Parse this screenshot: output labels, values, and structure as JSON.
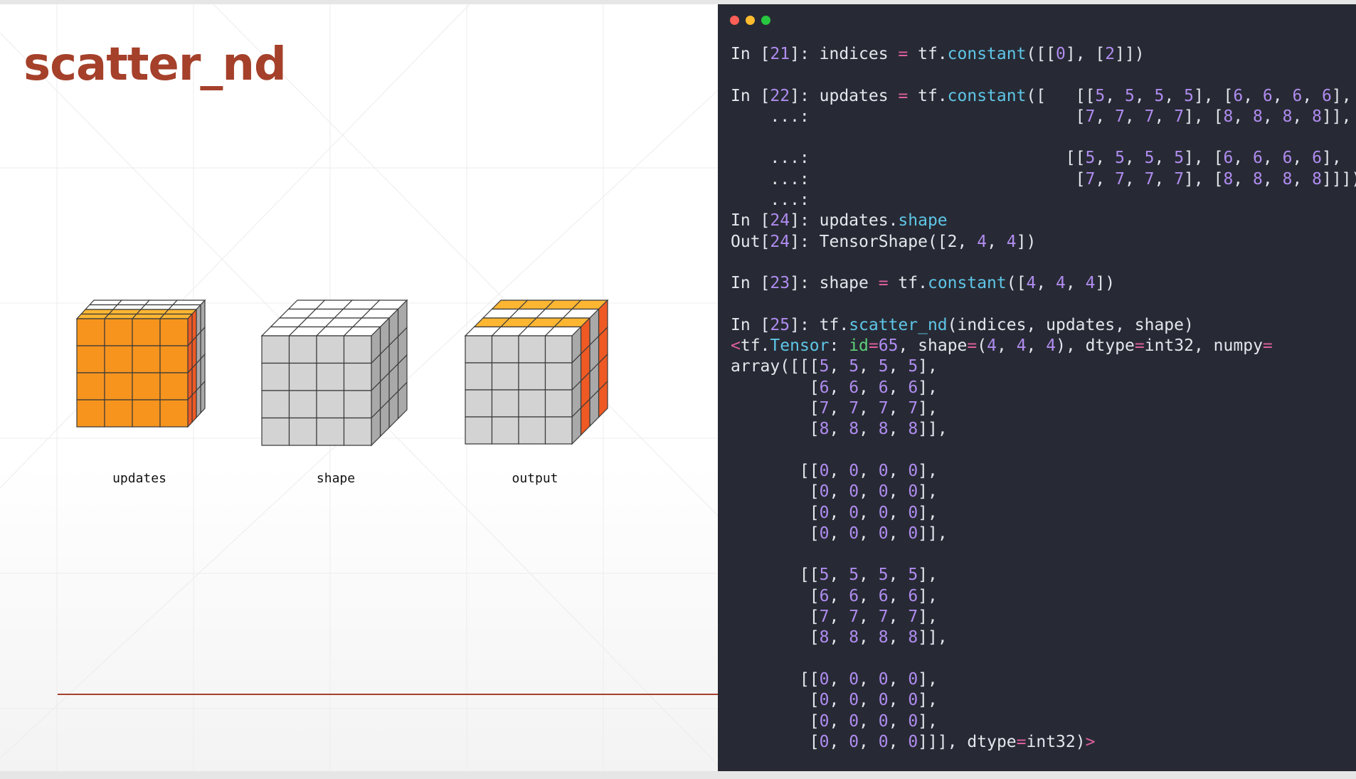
{
  "slide": {
    "title": "scatter_nd",
    "labels": {
      "updates": "updates",
      "shape": "shape",
      "output": "output"
    }
  },
  "colors": {
    "accent": "#a5402a",
    "cube_orange_front": "#f7941d",
    "cube_orange_top": "#fcb632",
    "cube_orange_side": "#ef5a24",
    "cube_gray_front": "#d3d3d3",
    "cube_gray_top": "#ffffff",
    "cube_gray_side": "#a9a9a9",
    "terminal_bg": "#272a34",
    "number": "#b08cf0",
    "function": "#5fc6e8",
    "operator": "#e05fa0",
    "keyword": "#5fd07a"
  },
  "terminal": {
    "lines": [
      [
        [
          "t",
          "In ["
        ],
        [
          "n",
          "21"
        ],
        [
          "t",
          "]: indices "
        ],
        [
          "o",
          "="
        ],
        [
          "t",
          " tf."
        ],
        [
          "f",
          "constant"
        ],
        [
          "t",
          "([["
        ],
        [
          "n",
          "0"
        ],
        [
          "t",
          "], ["
        ],
        [
          "n",
          "2"
        ],
        [
          "t",
          "]])"
        ]
      ],
      [],
      [
        [
          "t",
          "In ["
        ],
        [
          "n",
          "22"
        ],
        [
          "t",
          "]: updates "
        ],
        [
          "o",
          "="
        ],
        [
          "t",
          " tf."
        ],
        [
          "f",
          "constant"
        ],
        [
          "t",
          "([   [["
        ],
        [
          "n",
          "5"
        ],
        [
          "t",
          ", "
        ],
        [
          "n",
          "5"
        ],
        [
          "t",
          ", "
        ],
        [
          "n",
          "5"
        ],
        [
          "t",
          ", "
        ],
        [
          "n",
          "5"
        ],
        [
          "t",
          "], ["
        ],
        [
          "n",
          "6"
        ],
        [
          "t",
          ", "
        ],
        [
          "n",
          "6"
        ],
        [
          "t",
          ", "
        ],
        [
          "n",
          "6"
        ],
        [
          "t",
          ", "
        ],
        [
          "n",
          "6"
        ],
        [
          "t",
          "],"
        ]
      ],
      [
        [
          "t",
          "    ...:                           ["
        ],
        [
          "n",
          "7"
        ],
        [
          "t",
          ", "
        ],
        [
          "n",
          "7"
        ],
        [
          "t",
          ", "
        ],
        [
          "n",
          "7"
        ],
        [
          "t",
          ", "
        ],
        [
          "n",
          "7"
        ],
        [
          "t",
          "], ["
        ],
        [
          "n",
          "8"
        ],
        [
          "t",
          ", "
        ],
        [
          "n",
          "8"
        ],
        [
          "t",
          ", "
        ],
        [
          "n",
          "8"
        ],
        [
          "t",
          ", "
        ],
        [
          "n",
          "8"
        ],
        [
          "t",
          "]],"
        ]
      ],
      [],
      [
        [
          "t",
          "    ...:                          [["
        ],
        [
          "n",
          "5"
        ],
        [
          "t",
          ", "
        ],
        [
          "n",
          "5"
        ],
        [
          "t",
          ", "
        ],
        [
          "n",
          "5"
        ],
        [
          "t",
          ", "
        ],
        [
          "n",
          "5"
        ],
        [
          "t",
          "], ["
        ],
        [
          "n",
          "6"
        ],
        [
          "t",
          ", "
        ],
        [
          "n",
          "6"
        ],
        [
          "t",
          ", "
        ],
        [
          "n",
          "6"
        ],
        [
          "t",
          ", "
        ],
        [
          "n",
          "6"
        ],
        [
          "t",
          "],"
        ]
      ],
      [
        [
          "t",
          "    ...:                           ["
        ],
        [
          "n",
          "7"
        ],
        [
          "t",
          ", "
        ],
        [
          "n",
          "7"
        ],
        [
          "t",
          ", "
        ],
        [
          "n",
          "7"
        ],
        [
          "t",
          ", "
        ],
        [
          "n",
          "7"
        ],
        [
          "t",
          "], ["
        ],
        [
          "n",
          "8"
        ],
        [
          "t",
          ", "
        ],
        [
          "n",
          "8"
        ],
        [
          "t",
          ", "
        ],
        [
          "n",
          "8"
        ],
        [
          "t",
          ", "
        ],
        [
          "n",
          "8"
        ],
        [
          "t",
          "]]])"
        ]
      ],
      [
        [
          "t",
          "    ...:"
        ]
      ],
      [
        [
          "t",
          "In ["
        ],
        [
          "n",
          "24"
        ],
        [
          "t",
          "]: updates."
        ],
        [
          "f",
          "shape"
        ]
      ],
      [
        [
          "t",
          "Out["
        ],
        [
          "n",
          "24"
        ],
        [
          "t",
          "]: TensorShape([2, "
        ],
        [
          "n",
          "4"
        ],
        [
          "t",
          ", "
        ],
        [
          "n",
          "4"
        ],
        [
          "t",
          "])"
        ]
      ],
      [],
      [
        [
          "t",
          "In ["
        ],
        [
          "n",
          "23"
        ],
        [
          "t",
          "]: shape "
        ],
        [
          "o",
          "="
        ],
        [
          "t",
          " tf."
        ],
        [
          "f",
          "constant"
        ],
        [
          "t",
          "(["
        ],
        [
          "n",
          "4"
        ],
        [
          "t",
          ", "
        ],
        [
          "n",
          "4"
        ],
        [
          "t",
          ", "
        ],
        [
          "n",
          "4"
        ],
        [
          "t",
          "])"
        ]
      ],
      [],
      [
        [
          "t",
          "In ["
        ],
        [
          "n",
          "25"
        ],
        [
          "t",
          "]: tf."
        ],
        [
          "f",
          "scatter_nd"
        ],
        [
          "t",
          "(indices, updates, shape)"
        ]
      ],
      [
        [
          "o",
          "<"
        ],
        [
          "t",
          "tf."
        ],
        [
          "f",
          "Tensor"
        ],
        [
          "t",
          ": "
        ],
        [
          "k",
          "id"
        ],
        [
          "o",
          "="
        ],
        [
          "n",
          "65"
        ],
        [
          "t",
          ", shape"
        ],
        [
          "o",
          "="
        ],
        [
          "t",
          "("
        ],
        [
          "n",
          "4"
        ],
        [
          "t",
          ", "
        ],
        [
          "n",
          "4"
        ],
        [
          "t",
          ", "
        ],
        [
          "n",
          "4"
        ],
        [
          "t",
          "), dtype"
        ],
        [
          "o",
          "="
        ],
        [
          "t",
          "int32, numpy"
        ],
        [
          "o",
          "="
        ]
      ],
      [
        [
          "t",
          "array([[["
        ],
        [
          "n",
          "5"
        ],
        [
          "t",
          ", "
        ],
        [
          "n",
          "5"
        ],
        [
          "t",
          ", "
        ],
        [
          "n",
          "5"
        ],
        [
          "t",
          ", "
        ],
        [
          "n",
          "5"
        ],
        [
          "t",
          "],"
        ]
      ],
      [
        [
          "t",
          "        ["
        ],
        [
          "n",
          "6"
        ],
        [
          "t",
          ", "
        ],
        [
          "n",
          "6"
        ],
        [
          "t",
          ", "
        ],
        [
          "n",
          "6"
        ],
        [
          "t",
          ", "
        ],
        [
          "n",
          "6"
        ],
        [
          "t",
          "],"
        ]
      ],
      [
        [
          "t",
          "        ["
        ],
        [
          "n",
          "7"
        ],
        [
          "t",
          ", "
        ],
        [
          "n",
          "7"
        ],
        [
          "t",
          ", "
        ],
        [
          "n",
          "7"
        ],
        [
          "t",
          ", "
        ],
        [
          "n",
          "7"
        ],
        [
          "t",
          "],"
        ]
      ],
      [
        [
          "t",
          "        ["
        ],
        [
          "n",
          "8"
        ],
        [
          "t",
          ", "
        ],
        [
          "n",
          "8"
        ],
        [
          "t",
          ", "
        ],
        [
          "n",
          "8"
        ],
        [
          "t",
          ", "
        ],
        [
          "n",
          "8"
        ],
        [
          "t",
          "]],"
        ]
      ],
      [],
      [
        [
          "t",
          "       [["
        ],
        [
          "n",
          "0"
        ],
        [
          "t",
          ", "
        ],
        [
          "n",
          "0"
        ],
        [
          "t",
          ", "
        ],
        [
          "n",
          "0"
        ],
        [
          "t",
          ", "
        ],
        [
          "n",
          "0"
        ],
        [
          "t",
          "],"
        ]
      ],
      [
        [
          "t",
          "        ["
        ],
        [
          "n",
          "0"
        ],
        [
          "t",
          ", "
        ],
        [
          "n",
          "0"
        ],
        [
          "t",
          ", "
        ],
        [
          "n",
          "0"
        ],
        [
          "t",
          ", "
        ],
        [
          "n",
          "0"
        ],
        [
          "t",
          "],"
        ]
      ],
      [
        [
          "t",
          "        ["
        ],
        [
          "n",
          "0"
        ],
        [
          "t",
          ", "
        ],
        [
          "n",
          "0"
        ],
        [
          "t",
          ", "
        ],
        [
          "n",
          "0"
        ],
        [
          "t",
          ", "
        ],
        [
          "n",
          "0"
        ],
        [
          "t",
          "],"
        ]
      ],
      [
        [
          "t",
          "        ["
        ],
        [
          "n",
          "0"
        ],
        [
          "t",
          ", "
        ],
        [
          "n",
          "0"
        ],
        [
          "t",
          ", "
        ],
        [
          "n",
          "0"
        ],
        [
          "t",
          ", "
        ],
        [
          "n",
          "0"
        ],
        [
          "t",
          "]],"
        ]
      ],
      [],
      [
        [
          "t",
          "       [["
        ],
        [
          "n",
          "5"
        ],
        [
          "t",
          ", "
        ],
        [
          "n",
          "5"
        ],
        [
          "t",
          ", "
        ],
        [
          "n",
          "5"
        ],
        [
          "t",
          ", "
        ],
        [
          "n",
          "5"
        ],
        [
          "t",
          "],"
        ]
      ],
      [
        [
          "t",
          "        ["
        ],
        [
          "n",
          "6"
        ],
        [
          "t",
          ", "
        ],
        [
          "n",
          "6"
        ],
        [
          "t",
          ", "
        ],
        [
          "n",
          "6"
        ],
        [
          "t",
          ", "
        ],
        [
          "n",
          "6"
        ],
        [
          "t",
          "],"
        ]
      ],
      [
        [
          "t",
          "        ["
        ],
        [
          "n",
          "7"
        ],
        [
          "t",
          ", "
        ],
        [
          "n",
          "7"
        ],
        [
          "t",
          ", "
        ],
        [
          "n",
          "7"
        ],
        [
          "t",
          ", "
        ],
        [
          "n",
          "7"
        ],
        [
          "t",
          "],"
        ]
      ],
      [
        [
          "t",
          "        ["
        ],
        [
          "n",
          "8"
        ],
        [
          "t",
          ", "
        ],
        [
          "n",
          "8"
        ],
        [
          "t",
          ", "
        ],
        [
          "n",
          "8"
        ],
        [
          "t",
          ", "
        ],
        [
          "n",
          "8"
        ],
        [
          "t",
          "]],"
        ]
      ],
      [],
      [
        [
          "t",
          "       [["
        ],
        [
          "n",
          "0"
        ],
        [
          "t",
          ", "
        ],
        [
          "n",
          "0"
        ],
        [
          "t",
          ", "
        ],
        [
          "n",
          "0"
        ],
        [
          "t",
          ", "
        ],
        [
          "n",
          "0"
        ],
        [
          "t",
          "],"
        ]
      ],
      [
        [
          "t",
          "        ["
        ],
        [
          "n",
          "0"
        ],
        [
          "t",
          ", "
        ],
        [
          "n",
          "0"
        ],
        [
          "t",
          ", "
        ],
        [
          "n",
          "0"
        ],
        [
          "t",
          ", "
        ],
        [
          "n",
          "0"
        ],
        [
          "t",
          "],"
        ]
      ],
      [
        [
          "t",
          "        ["
        ],
        [
          "n",
          "0"
        ],
        [
          "t",
          ", "
        ],
        [
          "n",
          "0"
        ],
        [
          "t",
          ", "
        ],
        [
          "n",
          "0"
        ],
        [
          "t",
          ", "
        ],
        [
          "n",
          "0"
        ],
        [
          "t",
          "],"
        ]
      ],
      [
        [
          "t",
          "        ["
        ],
        [
          "n",
          "0"
        ],
        [
          "t",
          ", "
        ],
        [
          "n",
          "0"
        ],
        [
          "t",
          ", "
        ],
        [
          "n",
          "0"
        ],
        [
          "t",
          ", "
        ],
        [
          "n",
          "0"
        ],
        [
          "t",
          "]]], dtype"
        ],
        [
          "o",
          "="
        ],
        [
          "t",
          "int32)"
        ],
        [
          "o",
          ">"
        ]
      ]
    ]
  }
}
